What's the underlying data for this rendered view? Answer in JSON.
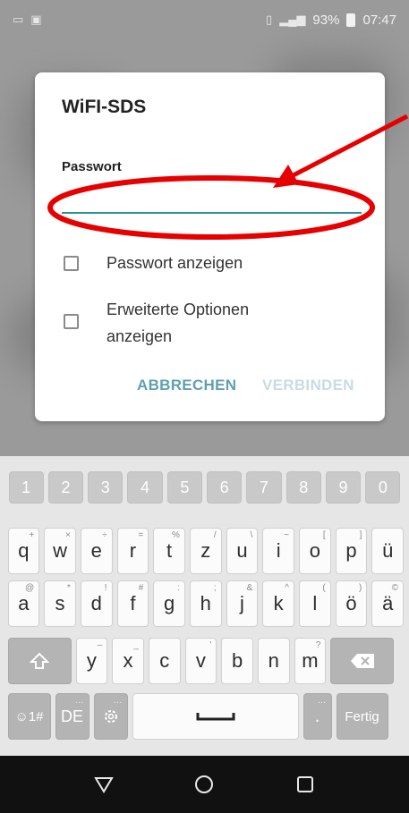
{
  "status_bar": {
    "battery_percent": "93%",
    "time": "07:47"
  },
  "dialog": {
    "title": "WiFI-SDS",
    "password_label": "Passwort",
    "password_value": "",
    "show_password_label": "Passwort anzeigen",
    "advanced_options_label": "Erweiterte Optionen anzeigen",
    "cancel_button": "ABBRECHEN",
    "connect_button": "VERBINDEN"
  },
  "keyboard": {
    "number_row": [
      "1",
      "2",
      "3",
      "4",
      "5",
      "6",
      "7",
      "8",
      "9",
      "0"
    ],
    "row1": [
      {
        "k": "q",
        "h": "+"
      },
      {
        "k": "w",
        "h": "×"
      },
      {
        "k": "e",
        "h": "÷"
      },
      {
        "k": "r",
        "h": "="
      },
      {
        "k": "t",
        "h": "%"
      },
      {
        "k": "z",
        "h": "/"
      },
      {
        "k": "u",
        "h": "\\"
      },
      {
        "k": "i",
        "h": "~"
      },
      {
        "k": "o",
        "h": "["
      },
      {
        "k": "p",
        "h": "]"
      },
      {
        "k": "ü",
        "h": ""
      }
    ],
    "row2": [
      {
        "k": "a",
        "h": "@"
      },
      {
        "k": "s",
        "h": "*"
      },
      {
        "k": "d",
        "h": "!"
      },
      {
        "k": "f",
        "h": "#"
      },
      {
        "k": "g",
        "h": ":"
      },
      {
        "k": "h",
        "h": ";"
      },
      {
        "k": "j",
        "h": "&"
      },
      {
        "k": "k",
        "h": "^"
      },
      {
        "k": "l",
        "h": "("
      },
      {
        "k": "ö",
        "h": ")"
      },
      {
        "k": "ä",
        "h": "©"
      }
    ],
    "row3": [
      {
        "k": "y",
        "h": "–"
      },
      {
        "k": "x",
        "h": "_"
      },
      {
        "k": "c",
        "h": ""
      },
      {
        "k": "v",
        "h": "'"
      },
      {
        "k": "b",
        "h": ""
      },
      {
        "k": "n",
        "h": ""
      },
      {
        "k": "m",
        "h": "?"
      }
    ],
    "symbols_key": "☺1#",
    "language_key": "DE",
    "period_key": ".",
    "done_key": "Fertig"
  },
  "colors": {
    "accent": "#2e8ea0",
    "annotation": "#e60000"
  },
  "icons": [
    "wifi-icon",
    "image-icon",
    "vibrate-icon",
    "signal-icon",
    "battery-icon",
    "shift-icon",
    "backspace-icon",
    "gear-icon",
    "space-icon",
    "back-icon",
    "home-icon",
    "recents-icon"
  ]
}
